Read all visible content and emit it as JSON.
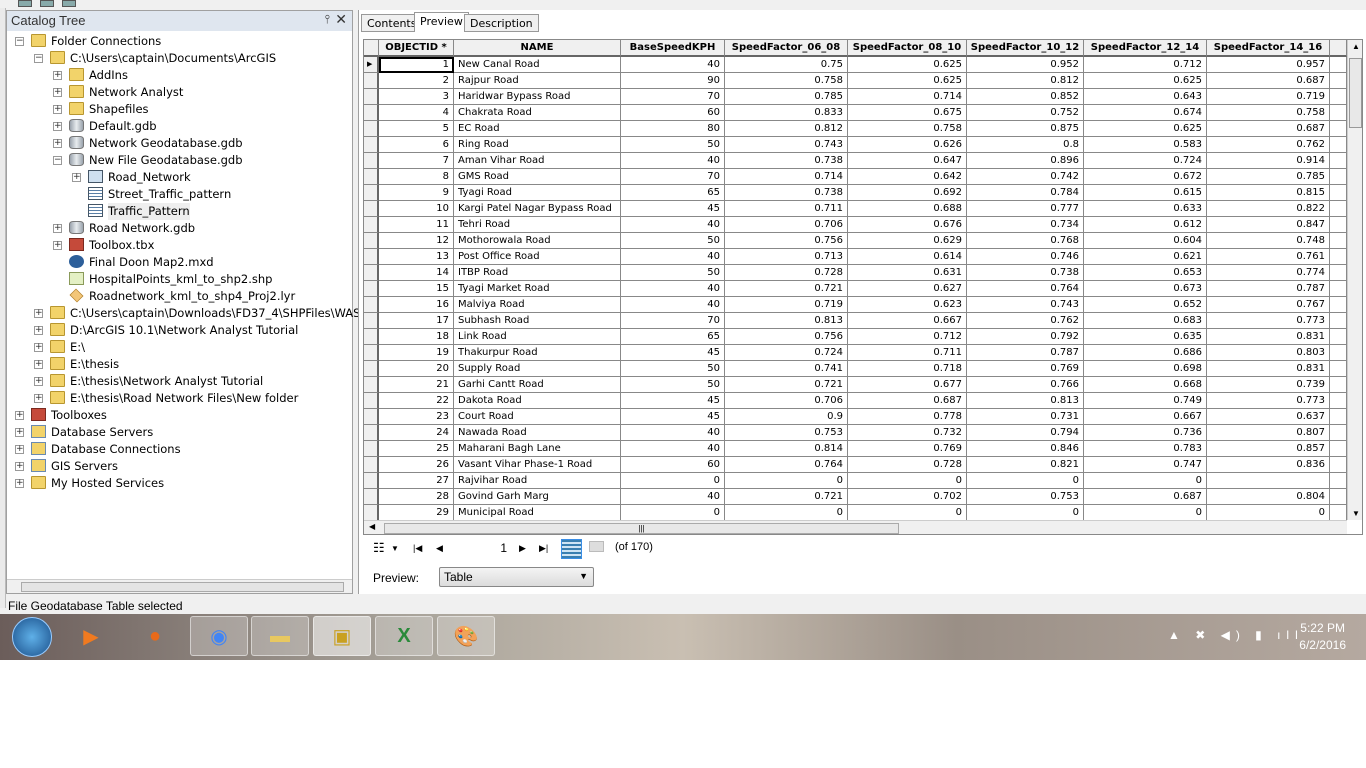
{
  "catalog": {
    "title": "Catalog Tree",
    "pin_icon": "pin-icon",
    "close_icon": "close-icon",
    "items": [
      {
        "level": 0,
        "exp": "minus",
        "icon": "folder",
        "label": "Folder Connections"
      },
      {
        "level": 1,
        "exp": "minus",
        "icon": "folder",
        "label": "C:\\Users\\captain\\Documents\\ArcGIS"
      },
      {
        "level": 2,
        "exp": "plus",
        "icon": "folder",
        "label": "AddIns"
      },
      {
        "level": 2,
        "exp": "plus",
        "icon": "folder",
        "label": "Network Analyst"
      },
      {
        "level": 2,
        "exp": "plus",
        "icon": "folder",
        "label": "Shapefiles"
      },
      {
        "level": 2,
        "exp": "plus",
        "icon": "gdb",
        "label": "Default.gdb"
      },
      {
        "level": 2,
        "exp": "plus",
        "icon": "gdb",
        "label": "Network Geodatabase.gdb"
      },
      {
        "level": 2,
        "exp": "minus",
        "icon": "gdb",
        "label": "New File Geodatabase.gdb"
      },
      {
        "level": 3,
        "exp": "plus",
        "icon": "dataset",
        "label": "Road_Network"
      },
      {
        "level": 3,
        "exp": "",
        "icon": "table",
        "label": "Street_Traffic_pattern"
      },
      {
        "level": 3,
        "exp": "",
        "icon": "table",
        "label": "Traffic_Pattern",
        "selected": true
      },
      {
        "level": 2,
        "exp": "plus",
        "icon": "gdb",
        "label": "Road Network.gdb"
      },
      {
        "level": 2,
        "exp": "plus",
        "icon": "toolbox",
        "label": "Toolbox.tbx"
      },
      {
        "level": 2,
        "exp": "",
        "icon": "mxd",
        "label": "Final Doon Map2.mxd"
      },
      {
        "level": 2,
        "exp": "",
        "icon": "shp",
        "label": "HospitalPoints_kml_to_shp2.shp"
      },
      {
        "level": 2,
        "exp": "",
        "icon": "lyr",
        "label": "Roadnetwork_kml_to_shp4_Proj2.lyr"
      },
      {
        "level": 1,
        "exp": "plus",
        "icon": "folder",
        "label": "C:\\Users\\captain\\Downloads\\FD37_4\\SHPFiles\\WASP"
      },
      {
        "level": 1,
        "exp": "plus",
        "icon": "folder",
        "label": "D:\\ArcGIS 10.1\\Network Analyst Tutorial"
      },
      {
        "level": 1,
        "exp": "plus",
        "icon": "folder",
        "label": "E:\\"
      },
      {
        "level": 1,
        "exp": "plus",
        "icon": "folder",
        "label": "E:\\thesis"
      },
      {
        "level": 1,
        "exp": "plus",
        "icon": "folder",
        "label": "E:\\thesis\\Network Analyst Tutorial"
      },
      {
        "level": 1,
        "exp": "plus",
        "icon": "folder",
        "label": "E:\\thesis\\Road Network Files\\New folder"
      },
      {
        "level": 0,
        "exp": "plus",
        "icon": "toolbox",
        "label": "Toolboxes"
      },
      {
        "level": 0,
        "exp": "plus",
        "icon": "server",
        "label": "Database Servers"
      },
      {
        "level": 0,
        "exp": "plus",
        "icon": "server",
        "label": "Database Connections"
      },
      {
        "level": 0,
        "exp": "plus",
        "icon": "server",
        "label": "GIS Servers"
      },
      {
        "level": 0,
        "exp": "plus",
        "icon": "folder",
        "label": "My Hosted Services"
      }
    ]
  },
  "tabs": [
    {
      "label": "Contents"
    },
    {
      "label": "Preview",
      "active": true
    },
    {
      "label": "Description"
    }
  ],
  "table": {
    "columns": [
      "OBJECTID *",
      "NAME",
      "BaseSpeedKPH",
      "SpeedFactor_06_08",
      "SpeedFactor_08_10",
      "SpeedFactor_10_12",
      "SpeedFactor_12_14",
      "SpeedFactor_14_16"
    ],
    "rows": [
      [
        "1",
        "New Canal Road",
        "40",
        "0.75",
        "0.625",
        "0.952",
        "0.712",
        "0.957"
      ],
      [
        "2",
        "Rajpur Road",
        "90",
        "0.758",
        "0.625",
        "0.812",
        "0.625",
        "0.687"
      ],
      [
        "3",
        "Haridwar Bypass Road",
        "70",
        "0.785",
        "0.714",
        "0.852",
        "0.643",
        "0.719"
      ],
      [
        "4",
        "Chakrata Road",
        "60",
        "0.833",
        "0.675",
        "0.752",
        "0.674",
        "0.758"
      ],
      [
        "5",
        "EC Road",
        "80",
        "0.812",
        "0.758",
        "0.875",
        "0.625",
        "0.687"
      ],
      [
        "6",
        "Ring Road",
        "50",
        "0.743",
        "0.626",
        "0.8",
        "0.583",
        "0.762"
      ],
      [
        "7",
        "Aman Vihar Road",
        "40",
        "0.738",
        "0.647",
        "0.896",
        "0.724",
        "0.914"
      ],
      [
        "8",
        "GMS Road",
        "70",
        "0.714",
        "0.642",
        "0.742",
        "0.672",
        "0.785"
      ],
      [
        "9",
        "Tyagi Road",
        "65",
        "0.738",
        "0.692",
        "0.784",
        "0.615",
        "0.815"
      ],
      [
        "10",
        "Kargi Patel Nagar Bypass Road",
        "45",
        "0.711",
        "0.688",
        "0.777",
        "0.633",
        "0.822"
      ],
      [
        "11",
        "Tehri Road",
        "40",
        "0.706",
        "0.676",
        "0.734",
        "0.612",
        "0.847"
      ],
      [
        "12",
        "Mothorowala Road",
        "50",
        "0.756",
        "0.629",
        "0.768",
        "0.604",
        "0.748"
      ],
      [
        "13",
        "Post Office Road",
        "40",
        "0.713",
        "0.614",
        "0.746",
        "0.621",
        "0.761"
      ],
      [
        "14",
        "ITBP Road",
        "50",
        "0.728",
        "0.631",
        "0.738",
        "0.653",
        "0.774"
      ],
      [
        "15",
        "Tyagi Market Road",
        "40",
        "0.721",
        "0.627",
        "0.764",
        "0.673",
        "0.787"
      ],
      [
        "16",
        "Malviya Road",
        "40",
        "0.719",
        "0.623",
        "0.743",
        "0.652",
        "0.767"
      ],
      [
        "17",
        "Subhash Road",
        "70",
        "0.813",
        "0.667",
        "0.762",
        "0.683",
        "0.773"
      ],
      [
        "18",
        "Link Road",
        "65",
        "0.756",
        "0.712",
        "0.792",
        "0.635",
        "0.831"
      ],
      [
        "19",
        "Thakurpur Road",
        "45",
        "0.724",
        "0.711",
        "0.787",
        "0.686",
        "0.803"
      ],
      [
        "20",
        "Supply Road",
        "50",
        "0.741",
        "0.718",
        "0.769",
        "0.698",
        "0.831"
      ],
      [
        "21",
        "Garhi Cantt Road",
        "50",
        "0.721",
        "0.677",
        "0.766",
        "0.668",
        "0.739"
      ],
      [
        "22",
        "Dakota Road",
        "45",
        "0.706",
        "0.687",
        "0.813",
        "0.749",
        "0.773"
      ],
      [
        "23",
        "Court Road",
        "45",
        "0.9",
        "0.778",
        "0.731",
        "0.667",
        "0.637"
      ],
      [
        "24",
        "Nawada Road",
        "40",
        "0.753",
        "0.732",
        "0.794",
        "0.736",
        "0.807"
      ],
      [
        "25",
        "Maharani Bagh Lane",
        "40",
        "0.814",
        "0.769",
        "0.846",
        "0.783",
        "0.857"
      ],
      [
        "26",
        "Vasant Vihar Phase-1 Road",
        "60",
        "0.764",
        "0.728",
        "0.821",
        "0.747",
        "0.836"
      ],
      [
        "27",
        "Rajvihar Road",
        "0",
        "0",
        "0",
        "0",
        "0",
        ""
      ],
      [
        "28",
        "Govind Garh Marg",
        "40",
        "0.721",
        "0.702",
        "0.753",
        "0.687",
        "0.804"
      ],
      [
        "29",
        "Municipal Road",
        "0",
        "0",
        "0",
        "0",
        "0",
        "0"
      ]
    ]
  },
  "nav": {
    "page": "1",
    "of_label": "(of 170)"
  },
  "preview": {
    "label": "Preview:",
    "value": "Table"
  },
  "status": "File Geodatabase Table selected",
  "taskbar": {
    "apps": [
      "start",
      "media-player",
      "firefox",
      "chrome",
      "explorer",
      "arccatalog",
      "excel",
      "paint"
    ],
    "time": "5:22 PM",
    "date": "6/2/2016"
  }
}
